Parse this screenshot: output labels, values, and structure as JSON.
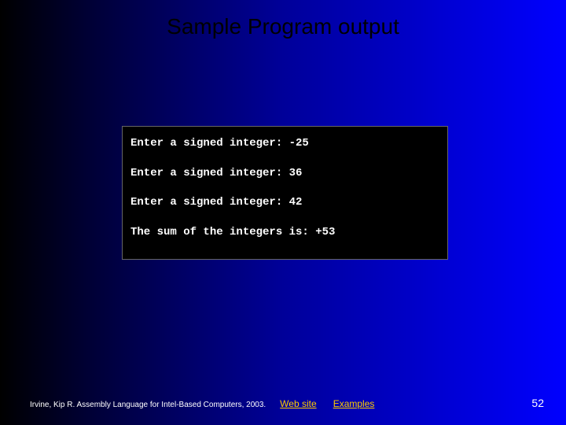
{
  "title": "Sample Program output",
  "console": {
    "lines": [
      "Enter a signed integer: -25",
      "Enter a signed integer: 36",
      "Enter a signed integer: 42",
      "The sum of the integers is: +53"
    ]
  },
  "footer": {
    "citation": "Irvine, Kip R. Assembly Language for Intel-Based Computers, 2003.",
    "link_website": "Web site",
    "link_examples": "Examples",
    "page_number": "52"
  }
}
